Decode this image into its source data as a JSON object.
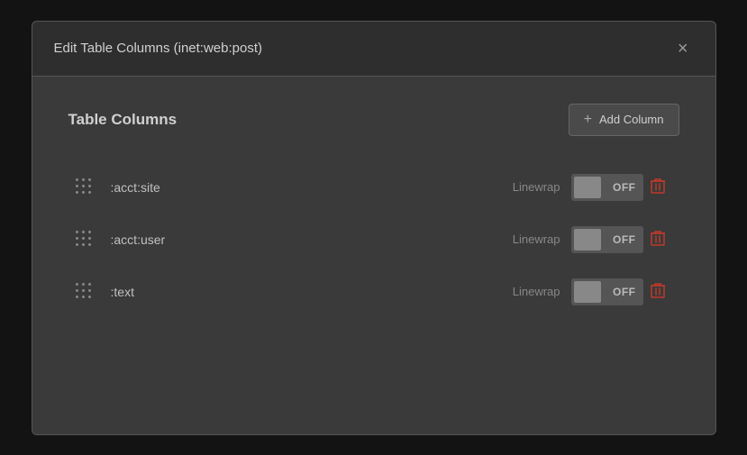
{
  "overlay": true,
  "dialog": {
    "title": "Edit Table Columns (inet:web:post)",
    "close_label": "×",
    "section_title": "Table Columns",
    "add_column_label": "Add Column",
    "columns": [
      {
        "name": ":acct:site",
        "linewrap_label": "Linewrap",
        "toggle_state": "OFF"
      },
      {
        "name": ":acct:user",
        "linewrap_label": "Linewrap",
        "toggle_state": "OFF"
      },
      {
        "name": ":text",
        "linewrap_label": "Linewrap",
        "toggle_state": "OFF"
      }
    ]
  }
}
